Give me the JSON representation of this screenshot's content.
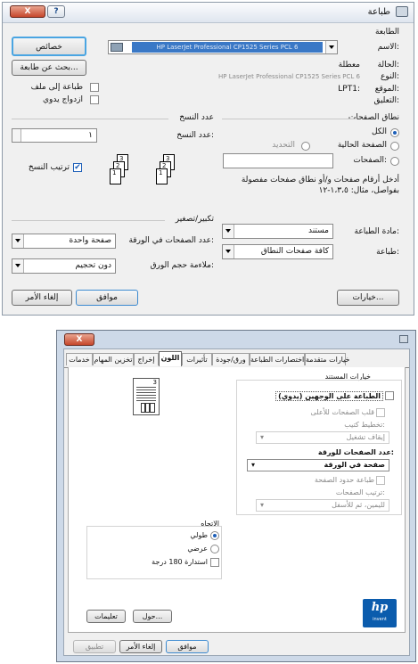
{
  "dialog1": {
    "title": "طباعة",
    "help_glyph": "?",
    "close_glyph": "X",
    "printer_section": "الطابعة",
    "name_label": "الاسم:",
    "printer_name": "HP LaserJet Professional CP1525 Series PCL 6",
    "status_label": "الحالة:",
    "status_value": "معطلة",
    "type_label": "النوع:",
    "type_value": "HP LaserJet Professional CP1525 Series PCL 6",
    "where_label": "الموقع:",
    "where_value": "LPT1:",
    "comment_label": "التعليق:",
    "properties_button": "خصائص",
    "find_printer_button": "بحث عن طابعة...",
    "print_to_file_label": "طباعة إلى ملف",
    "duplex_label": "ازدواج يدوي",
    "page_range_section": "نطاق الصفحات",
    "all_label": "الكل",
    "current_page_label": "الصفحة الحالية",
    "selection_label": "التحديد",
    "pages_label": "الصفحات:",
    "pages_value": "",
    "range_hint_line1": "أدخل أرقام صفحات و/أو نطاق صفحات مفصولة",
    "range_hint_line2": "بفواصل، مثال: ١،٣،٥-١٢",
    "copies_section": "عدد النسخ",
    "copies_label": "عدد النسخ:",
    "copies_value": "١",
    "collate_label": "ترتيب النسخ",
    "collate_pages": [
      "1",
      "2",
      "3"
    ],
    "print_what_label": "مادة الطباعة:",
    "print_what_value": "مستند",
    "print_label": "طباعة:",
    "print_value": "كافة صفحات النطاق",
    "zoom_section": "تكبير/تصغير",
    "pages_per_sheet_label": "عدد الصفحات في الورقة:",
    "pages_per_sheet_value": "صفحة واحدة",
    "scale_label": "ملاءمة حجم الورق:",
    "scale_value": "دون تحجيم",
    "options_button": "خيارات...",
    "ok_button": "موافق",
    "cancel_button": "إلغاء الأمر"
  },
  "dialog2": {
    "close_glyph": "X",
    "tabs": [
      "خدمات",
      "تخزين المهام",
      "إخراج",
      "اللون",
      "تأثيرات",
      "ورق/جودة",
      "اختصارات الطباعة",
      "خيارات متقدمة"
    ],
    "selected_tab_index": 3,
    "document_options_label": "خيارات المستند",
    "two_sided_label": "الطباعة على الوجهين (يدوي)",
    "flip_pages_label": "قلب الصفحات للأعلى",
    "booklet_layout_label": "تخطيط كتيب:",
    "booklet_layout_value": "إيقاف تشغيل",
    "pages_per_sheet_label": "عدد الصفحات للورقة:",
    "pages_per_sheet_value": "صفحة في الورقة",
    "print_borders_label": "طباعة حدود الصفحة",
    "page_order_label": "ترتيب الصفحات:",
    "page_order_value": "لليمين، ثم للأسفل",
    "orientation_label": "الاتجاه",
    "portrait_label": "طولي",
    "landscape_label": "عرضي",
    "rotate_label": "استدارة 180 درجة",
    "preview_page_number": "3",
    "about_button": "حول...",
    "help_button": "تعليمات",
    "ok_button": "موافق",
    "cancel_button": "إلغاء الأمر",
    "apply_button": "تطبيق",
    "logo_text": "hp",
    "logo_subtext": "invent"
  }
}
